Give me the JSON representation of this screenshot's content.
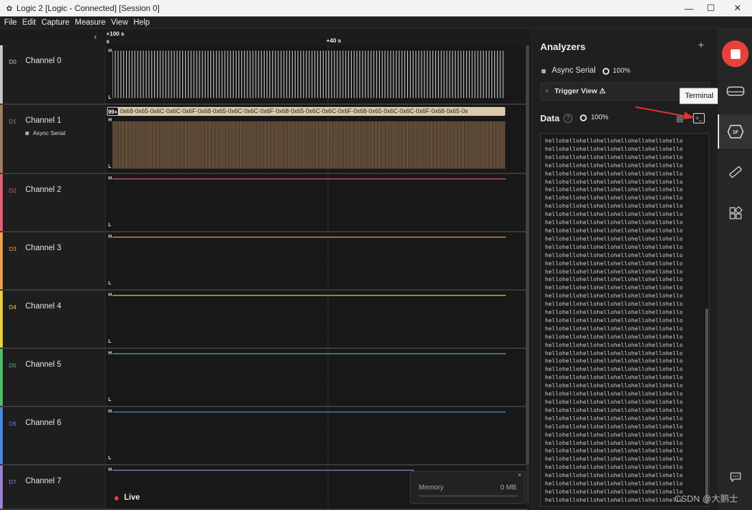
{
  "window": {
    "title": "Logic 2 [Logic - Connected] [Session 0]",
    "minimize": "—",
    "maximize": "☐",
    "close": "✕"
  },
  "menu": [
    "File",
    "Edit",
    "Capture",
    "Measure",
    "View",
    "Help"
  ],
  "ruler": {
    "left_label_top": "+100 s",
    "left_label_bottom": "s",
    "center_label": "+40 s"
  },
  "channels": [
    {
      "id": "D0",
      "name": "Channel 0",
      "color": "#c8c8c8",
      "sub": ""
    },
    {
      "id": "D1",
      "name": "Channel 1",
      "color": "#a08060",
      "sub": "Async Serial"
    },
    {
      "id": "D2",
      "name": "Channel 2",
      "color": "#e0607a",
      "sub": ""
    },
    {
      "id": "D3",
      "name": "Channel 3",
      "color": "#f0a050",
      "sub": ""
    },
    {
      "id": "D4",
      "name": "Channel 4",
      "color": "#e8d040",
      "sub": ""
    },
    {
      "id": "D5",
      "name": "Channel 5",
      "color": "#4fbf6a",
      "sub": ""
    },
    {
      "id": "D6",
      "name": "Channel 6",
      "color": "#4a8ae0",
      "sub": ""
    },
    {
      "id": "D7",
      "name": "Channel 7",
      "color": "#9a82d0",
      "sub": ""
    }
  ],
  "levels": {
    "high": "H",
    "low": "L"
  },
  "d1_decode": {
    "count": "99+",
    "text": "0x68·0x65·0x6C·0x6C·0x6F·0x68·0x65·0x6C·0x6C·0x6F·0x68·0x65·0x6C·0x6C·0x6F·0x68·0x65·0x6C·0x6C·0x6F·0x68·0x65·0x"
  },
  "analyzers": {
    "title": "Analyzers",
    "add": "+",
    "items": [
      {
        "name": "Async Serial",
        "progress": "100%"
      }
    ],
    "trigger_view": "Trigger View ⚠"
  },
  "data_panel": {
    "title": "Data",
    "help": "?",
    "progress": "100%",
    "tooltip": "Terminal",
    "terminal_line": "hellohellohellohellohellohellohellohello",
    "terminal_lines_count": 45
  },
  "memory": {
    "label": "Memory",
    "value": "0 MB",
    "close": "×"
  },
  "live": "Live",
  "watermark": "CSDN @大鹅士"
}
